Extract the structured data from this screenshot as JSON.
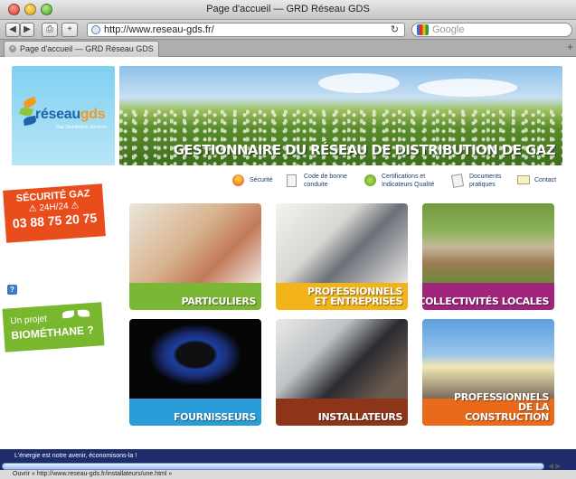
{
  "window": {
    "title": "Page d'accueil — GRD Réseau GDS"
  },
  "toolbar": {
    "url": "http://www.reseau-gds.fr/",
    "search_placeholder": "Google"
  },
  "tabs": [
    {
      "label": "Page d'accueil — GRD Réseau GDS"
    }
  ],
  "site": {
    "logo": {
      "reseau": "réseau",
      "gds": "gds",
      "tagline": "Gaz Distribution Services"
    },
    "banner_title": "GESTIONNAIRE DU RÉSEAU DE DISTRIBUTION DE GAZ",
    "nav": [
      {
        "label": "Sécurité",
        "icon": "safety-flame-icon"
      },
      {
        "label": "Code de bonne conduite",
        "icon": "document-icon"
      },
      {
        "label": "Certifications et Indicateurs Qualité",
        "icon": "certification-icon"
      },
      {
        "label": "Documents pratiques",
        "icon": "pen-document-icon"
      },
      {
        "label": "Contact",
        "icon": "envelope-icon"
      }
    ],
    "security_badge": {
      "line1": "SÉCURITÉ GAZ",
      "line2": "⚠ 24H/24 ⚠",
      "phone": "03 88 75 20 75"
    },
    "biomethane": {
      "line1": "Un projet",
      "line2": "BIOMÉTHANE ?"
    },
    "tiles": [
      {
        "label": "PARTICULIERS",
        "color": "#7ab735"
      },
      {
        "label": "PROFESSIONNELS ET ENTREPRISES",
        "color": "#f2b419"
      },
      {
        "label": "COLLECTIVITÉS LOCALES",
        "color": "#a0247c"
      },
      {
        "label": "FOURNISSEURS",
        "color": "#2a9dd8"
      },
      {
        "label": "INSTALLATEURS",
        "color": "#8e3418"
      },
      {
        "label": "PROFESSIONNELS DE LA CONSTRUCTION",
        "color": "#ea6a1b"
      }
    ],
    "footer_message": "L'énergie est notre avenir, économisons-la !"
  },
  "status": {
    "hover_url": "Ouvrir « http://www.reseau-gds.fr/installateurs/une.html »"
  }
}
